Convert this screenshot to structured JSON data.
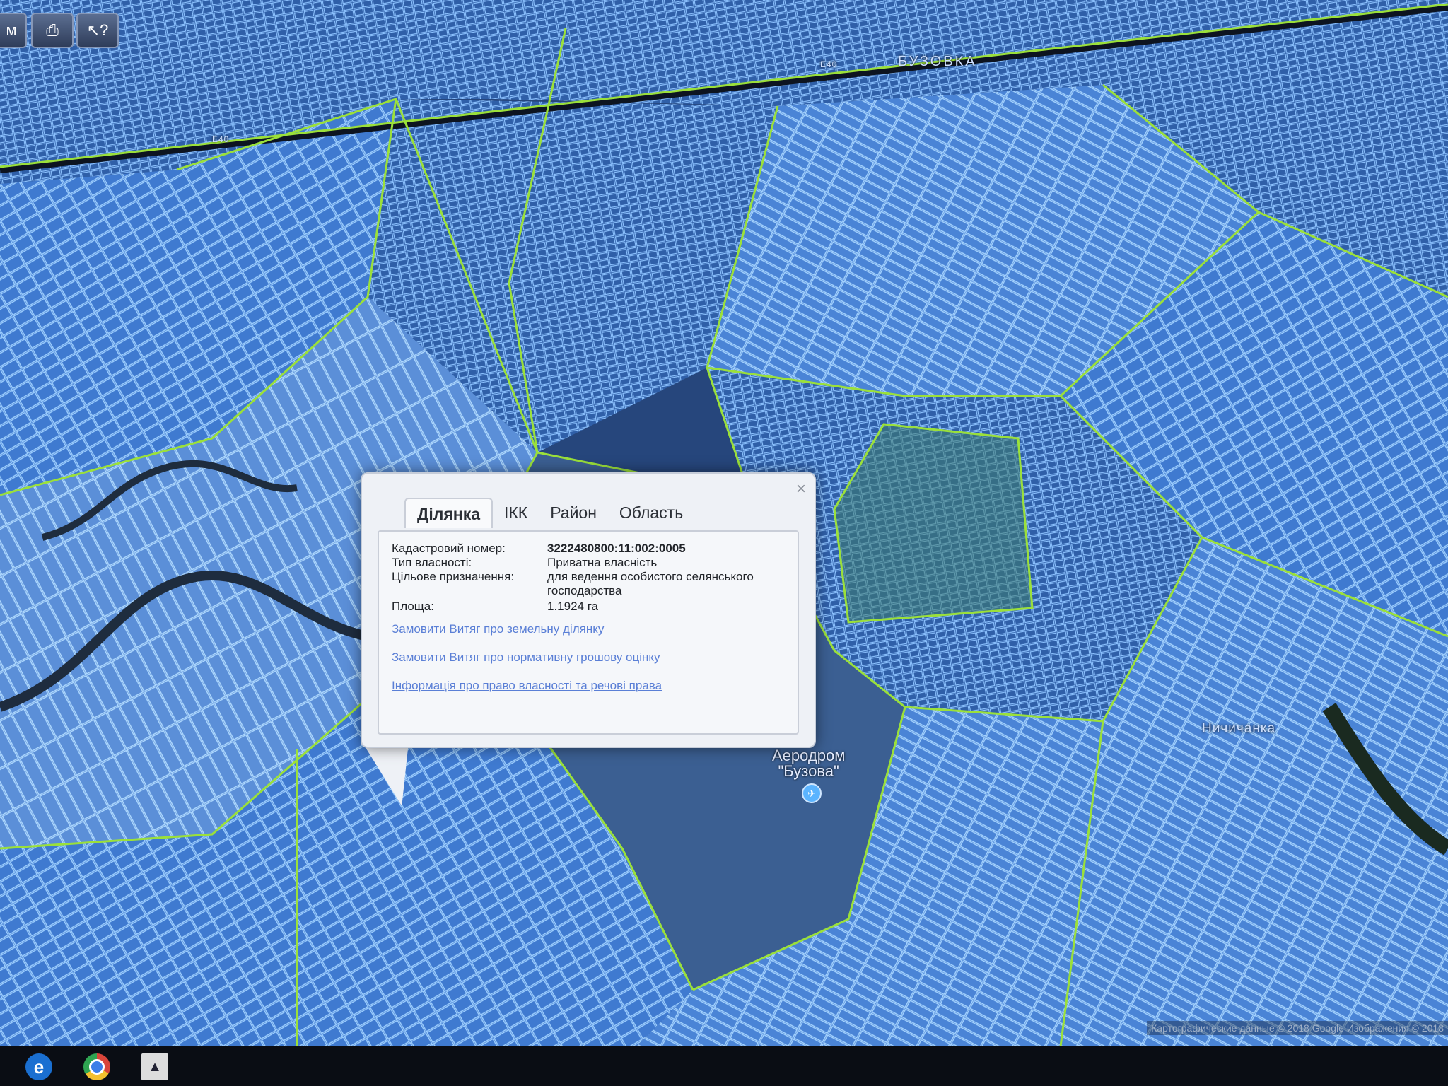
{
  "toolbar": {
    "measure_label": "м",
    "print_icon": "print-icon",
    "help_label": "?"
  },
  "map": {
    "road_label_1": "E40",
    "road_label_2": "E40",
    "town_label_top": "БУЗОВКА",
    "village_label_right": "Ничичанка",
    "airport_name": "Аеродром",
    "airport_quote": "\"Бузова\"",
    "copyright": "Картографические данные © 2018 Google Изображения © 2018"
  },
  "popup": {
    "tabs": [
      "Ділянка",
      "ІКК",
      "Район",
      "Область"
    ],
    "active_tab": 0,
    "fields": [
      {
        "label": "Кадастровий номер:",
        "value": "3222480800:11:002:0005"
      },
      {
        "label": "Тип власності:",
        "value": "Приватна власність"
      },
      {
        "label": "Цільове призначення:",
        "value": "для ведення особистого селянського господарства"
      },
      {
        "label": "Площа:",
        "value": "1.1924 га"
      }
    ],
    "links": [
      "Замовити Витяг про земельну ділянку",
      "Замовити Витяг про нормативну грошову оцінку",
      "Інформація про право власності та речові права"
    ],
    "close_label": "×"
  },
  "taskbar": {
    "apps": [
      "internet-explorer-icon",
      "chrome-icon",
      "photos-icon"
    ]
  },
  "colors": {
    "parcel_fill": "#3a72c4",
    "parcel_line": "#8fc4ff",
    "boundary_line": "#9be03a",
    "link": "#5a7fd6"
  }
}
